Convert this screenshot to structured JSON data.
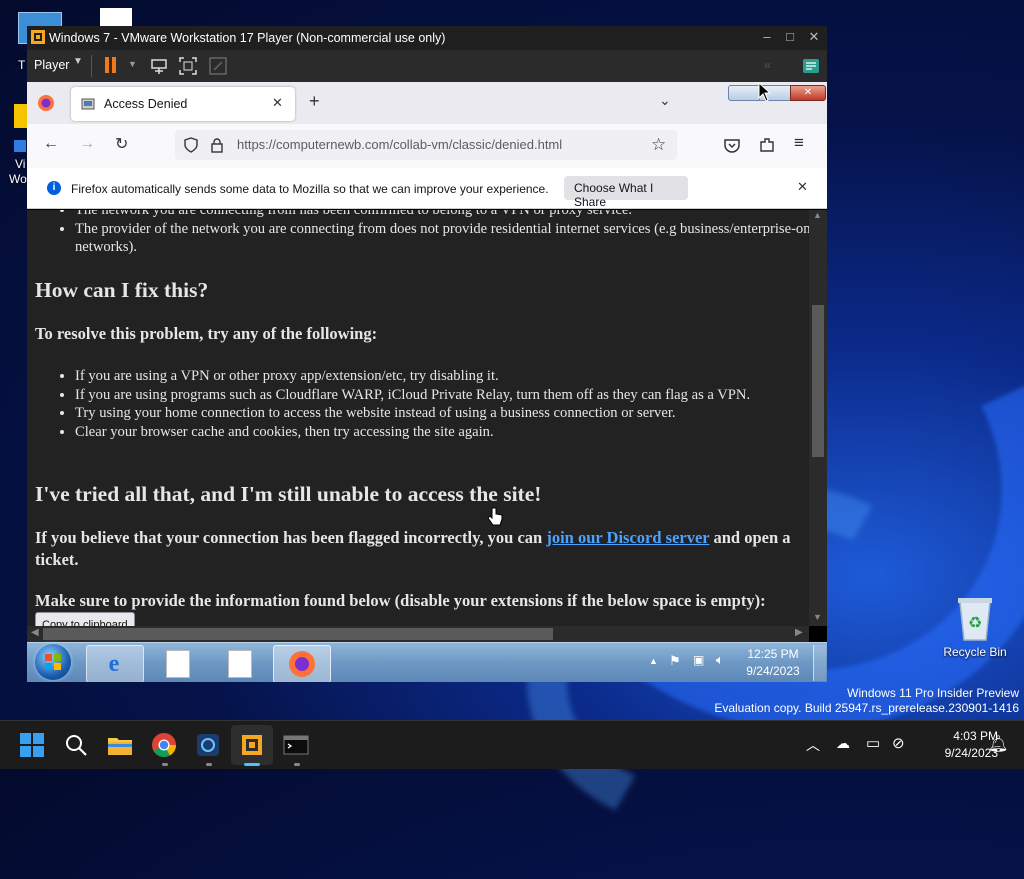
{
  "desktop": {
    "recycle_bin_label": "Recycle Bin",
    "left_icon_fragments": [
      "T",
      "Vi",
      "Wo"
    ],
    "watermark_line1": "Windows 11 Pro Insider Preview",
    "watermark_line2": "Evaluation copy. Build 25947.rs_prerelease.230901-1416"
  },
  "vmware": {
    "title": "Windows 7 - VMware Workstation 17 Player (Non-commercial use only)",
    "player_menu": "Player"
  },
  "firefox": {
    "tab_title": "Access Denied",
    "url_host": "https://computernewb.com",
    "url_path": "/collab-vm/classic/denied.html",
    "notification_text": "Firefox automatically sends some data to Mozilla so that we can improve your experience.",
    "notification_button": "Choose What I Share"
  },
  "page": {
    "list1": [
      "The network you are connecting from has been confirmed to belong to a VPN or proxy service.",
      "The provider of the network you are connecting from does not provide residential internet services (e.g business/enterprise-only networks)."
    ],
    "heading_fix": "How can I fix this?",
    "resolve_intro": "To resolve this problem, try any of the following:",
    "list2": [
      "If you are using a VPN or other proxy app/extension/etc, try disabling it.",
      "If you are using programs such as Cloudflare WARP, iCloud Private Relay, turn them off as they can flag as a VPN.",
      "Try using your home connection to access the website instead of using a business connection or server.",
      "Clear your browser cache and cookies, then try accessing the site again."
    ],
    "heading_tried": "I've tried all that, and I'm still unable to access the site!",
    "discord_pre": "If you believe that your connection has been flagged incorrectly, you can ",
    "discord_link": "join our Discord server",
    "discord_post": " and open a ticket.",
    "info_text": "Make sure to provide the information found below (disable your extensions if the below space is empty):",
    "copy_button": "Copy to clipboard"
  },
  "guest_taskbar": {
    "time": "12:25 PM",
    "date": "9/24/2023"
  },
  "host_taskbar": {
    "time": "4:03 PM",
    "date": "9/24/2023"
  },
  "colors": {
    "link": "#4aa3ff",
    "firefox_orange": "#ff7139",
    "vmware_orange": "#f5a623"
  }
}
